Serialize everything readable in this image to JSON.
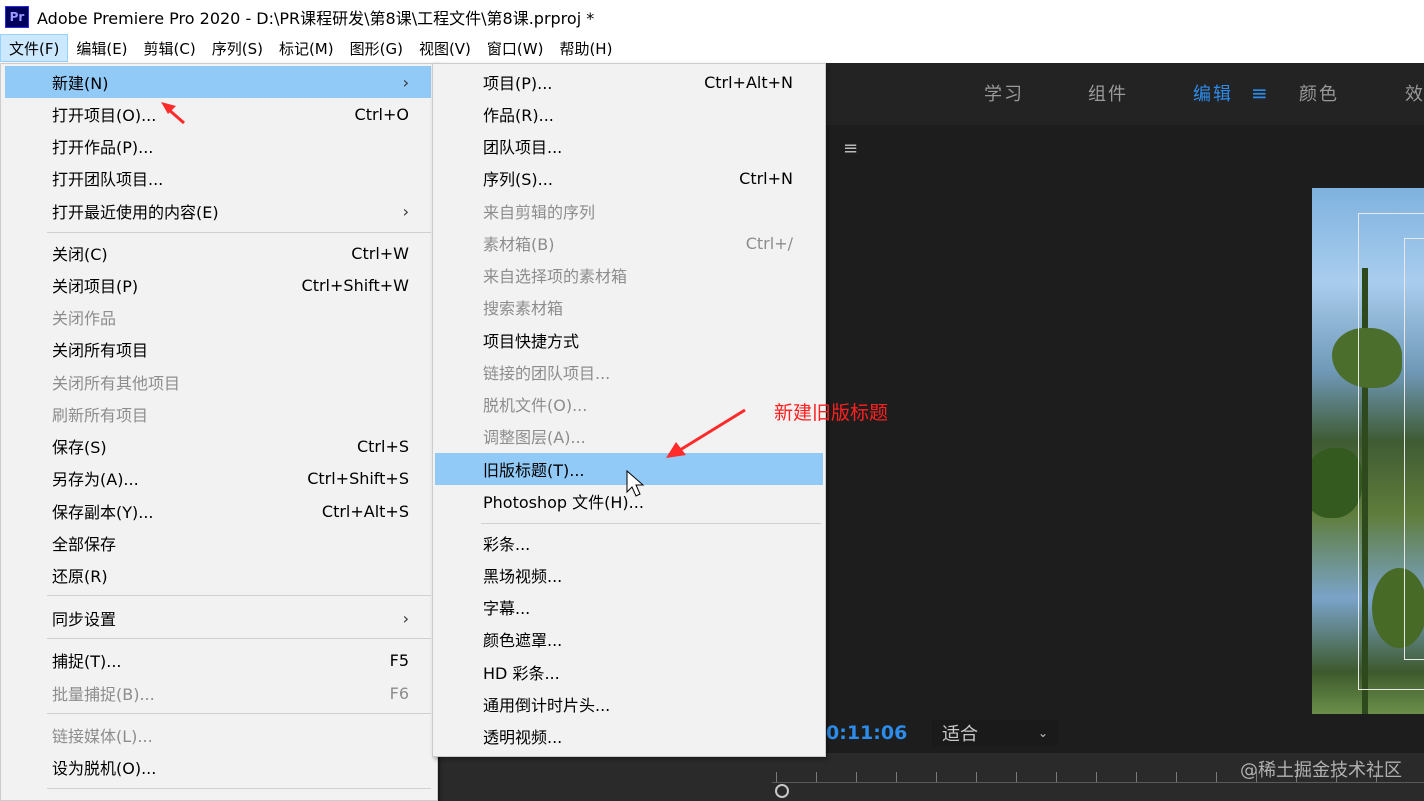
{
  "window": {
    "app_icon": "Pr",
    "title": "Adobe Premiere Pro 2020 - D:\\PR课程研发\\第8课\\工程文件\\第8课.prproj *"
  },
  "menubar": [
    "文件(F)",
    "编辑(E)",
    "剪辑(C)",
    "序列(S)",
    "标记(M)",
    "图形(G)",
    "视图(V)",
    "窗口(W)",
    "帮助(H)"
  ],
  "workspace_tabs": [
    "学习",
    "组件",
    "编辑",
    "颜色",
    "效"
  ],
  "monitor": {
    "timecode": "0:11:06",
    "fit": "适合"
  },
  "file_menu": [
    {
      "label": "新建(N)",
      "shortcut": "",
      "submenu": true,
      "highlighted": true
    },
    {
      "label": "打开项目(O)...",
      "shortcut": "Ctrl+O"
    },
    {
      "label": "打开作品(P)...",
      "shortcut": ""
    },
    {
      "label": "打开团队项目...",
      "shortcut": ""
    },
    {
      "label": "打开最近使用的内容(E)",
      "shortcut": "",
      "submenu": true
    },
    {
      "label": "关闭(C)",
      "shortcut": "Ctrl+W"
    },
    {
      "label": "关闭项目(P)",
      "shortcut": "Ctrl+Shift+W"
    },
    {
      "label": "关闭作品",
      "shortcut": "",
      "disabled": true
    },
    {
      "label": "关闭所有项目",
      "shortcut": ""
    },
    {
      "label": "关闭所有其他项目",
      "shortcut": "",
      "disabled": true
    },
    {
      "label": "刷新所有项目",
      "shortcut": "",
      "disabled": true
    },
    {
      "label": "保存(S)",
      "shortcut": "Ctrl+S"
    },
    {
      "label": "另存为(A)...",
      "shortcut": "Ctrl+Shift+S"
    },
    {
      "label": "保存副本(Y)...",
      "shortcut": "Ctrl+Alt+S"
    },
    {
      "label": "全部保存",
      "shortcut": ""
    },
    {
      "label": "还原(R)",
      "shortcut": ""
    },
    {
      "label": "同步设置",
      "shortcut": "",
      "submenu": true
    },
    {
      "label": "捕捉(T)...",
      "shortcut": "F5"
    },
    {
      "label": "批量捕捉(B)...",
      "shortcut": "F6",
      "disabled": true
    },
    {
      "label": "链接媒体(L)...",
      "shortcut": "",
      "disabled": true
    },
    {
      "label": "设为脱机(O)...",
      "shortcut": ""
    }
  ],
  "new_submenu": [
    {
      "label": "项目(P)...",
      "shortcut": "Ctrl+Alt+N"
    },
    {
      "label": "作品(R)...",
      "shortcut": ""
    },
    {
      "label": "团队项目...",
      "shortcut": ""
    },
    {
      "label": "序列(S)...",
      "shortcut": "Ctrl+N"
    },
    {
      "label": "来自剪辑的序列",
      "shortcut": "",
      "disabled": true
    },
    {
      "label": "素材箱(B)",
      "shortcut": "Ctrl+/",
      "disabled": true
    },
    {
      "label": "来自选择项的素材箱",
      "shortcut": "",
      "disabled": true
    },
    {
      "label": "搜索素材箱",
      "shortcut": "",
      "disabled": true
    },
    {
      "label": "项目快捷方式",
      "shortcut": ""
    },
    {
      "label": "链接的团队项目...",
      "shortcut": "",
      "disabled": true
    },
    {
      "label": "脱机文件(O)...",
      "shortcut": "",
      "disabled": true
    },
    {
      "label": "调整图层(A)...",
      "shortcut": "",
      "disabled": true
    },
    {
      "label": "旧版标题(T)...",
      "shortcut": "",
      "highlighted": true
    },
    {
      "label": "Photoshop 文件(H)...",
      "shortcut": ""
    },
    {
      "label": "彩条...",
      "shortcut": ""
    },
    {
      "label": "黑场视频...",
      "shortcut": ""
    },
    {
      "label": "字幕...",
      "shortcut": ""
    },
    {
      "label": "颜色遮罩...",
      "shortcut": ""
    },
    {
      "label": "HD 彩条...",
      "shortcut": ""
    },
    {
      "label": "通用倒计时片头...",
      "shortcut": ""
    },
    {
      "label": "透明视频...",
      "shortcut": ""
    }
  ],
  "annotation": "新建旧版标题",
  "watermark": "@稀土掘金技术社区",
  "colors": {
    "highlight": "#91c9f7",
    "accent_blue": "#2d8ceb",
    "annotation_red": "#ff2020"
  }
}
